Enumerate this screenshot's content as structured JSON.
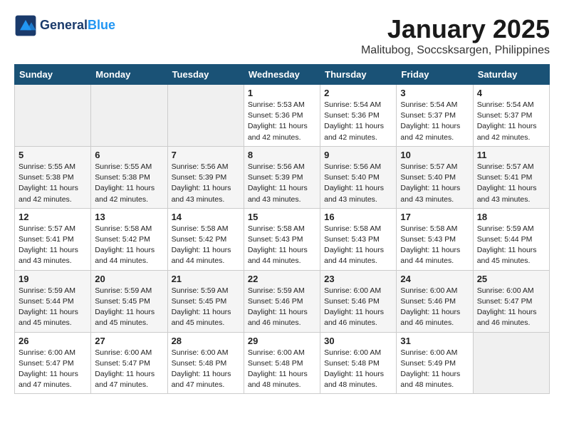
{
  "header": {
    "logo_line1": "General",
    "logo_line2": "Blue",
    "month": "January 2025",
    "location": "Malitubog, Soccsksargen, Philippines"
  },
  "days_of_week": [
    "Sunday",
    "Monday",
    "Tuesday",
    "Wednesday",
    "Thursday",
    "Friday",
    "Saturday"
  ],
  "weeks": [
    [
      {
        "day": "",
        "content": ""
      },
      {
        "day": "",
        "content": ""
      },
      {
        "day": "",
        "content": ""
      },
      {
        "day": "1",
        "content": "Sunrise: 5:53 AM\nSunset: 5:36 PM\nDaylight: 11 hours\nand 42 minutes."
      },
      {
        "day": "2",
        "content": "Sunrise: 5:54 AM\nSunset: 5:36 PM\nDaylight: 11 hours\nand 42 minutes."
      },
      {
        "day": "3",
        "content": "Sunrise: 5:54 AM\nSunset: 5:37 PM\nDaylight: 11 hours\nand 42 minutes."
      },
      {
        "day": "4",
        "content": "Sunrise: 5:54 AM\nSunset: 5:37 PM\nDaylight: 11 hours\nand 42 minutes."
      }
    ],
    [
      {
        "day": "5",
        "content": "Sunrise: 5:55 AM\nSunset: 5:38 PM\nDaylight: 11 hours\nand 42 minutes."
      },
      {
        "day": "6",
        "content": "Sunrise: 5:55 AM\nSunset: 5:38 PM\nDaylight: 11 hours\nand 42 minutes."
      },
      {
        "day": "7",
        "content": "Sunrise: 5:56 AM\nSunset: 5:39 PM\nDaylight: 11 hours\nand 43 minutes."
      },
      {
        "day": "8",
        "content": "Sunrise: 5:56 AM\nSunset: 5:39 PM\nDaylight: 11 hours\nand 43 minutes."
      },
      {
        "day": "9",
        "content": "Sunrise: 5:56 AM\nSunset: 5:40 PM\nDaylight: 11 hours\nand 43 minutes."
      },
      {
        "day": "10",
        "content": "Sunrise: 5:57 AM\nSunset: 5:40 PM\nDaylight: 11 hours\nand 43 minutes."
      },
      {
        "day": "11",
        "content": "Sunrise: 5:57 AM\nSunset: 5:41 PM\nDaylight: 11 hours\nand 43 minutes."
      }
    ],
    [
      {
        "day": "12",
        "content": "Sunrise: 5:57 AM\nSunset: 5:41 PM\nDaylight: 11 hours\nand 43 minutes."
      },
      {
        "day": "13",
        "content": "Sunrise: 5:58 AM\nSunset: 5:42 PM\nDaylight: 11 hours\nand 44 minutes."
      },
      {
        "day": "14",
        "content": "Sunrise: 5:58 AM\nSunset: 5:42 PM\nDaylight: 11 hours\nand 44 minutes."
      },
      {
        "day": "15",
        "content": "Sunrise: 5:58 AM\nSunset: 5:43 PM\nDaylight: 11 hours\nand 44 minutes."
      },
      {
        "day": "16",
        "content": "Sunrise: 5:58 AM\nSunset: 5:43 PM\nDaylight: 11 hours\nand 44 minutes."
      },
      {
        "day": "17",
        "content": "Sunrise: 5:58 AM\nSunset: 5:43 PM\nDaylight: 11 hours\nand 44 minutes."
      },
      {
        "day": "18",
        "content": "Sunrise: 5:59 AM\nSunset: 5:44 PM\nDaylight: 11 hours\nand 45 minutes."
      }
    ],
    [
      {
        "day": "19",
        "content": "Sunrise: 5:59 AM\nSunset: 5:44 PM\nDaylight: 11 hours\nand 45 minutes."
      },
      {
        "day": "20",
        "content": "Sunrise: 5:59 AM\nSunset: 5:45 PM\nDaylight: 11 hours\nand 45 minutes."
      },
      {
        "day": "21",
        "content": "Sunrise: 5:59 AM\nSunset: 5:45 PM\nDaylight: 11 hours\nand 45 minutes."
      },
      {
        "day": "22",
        "content": "Sunrise: 5:59 AM\nSunset: 5:46 PM\nDaylight: 11 hours\nand 46 minutes."
      },
      {
        "day": "23",
        "content": "Sunrise: 6:00 AM\nSunset: 5:46 PM\nDaylight: 11 hours\nand 46 minutes."
      },
      {
        "day": "24",
        "content": "Sunrise: 6:00 AM\nSunset: 5:46 PM\nDaylight: 11 hours\nand 46 minutes."
      },
      {
        "day": "25",
        "content": "Sunrise: 6:00 AM\nSunset: 5:47 PM\nDaylight: 11 hours\nand 46 minutes."
      }
    ],
    [
      {
        "day": "26",
        "content": "Sunrise: 6:00 AM\nSunset: 5:47 PM\nDaylight: 11 hours\nand 47 minutes."
      },
      {
        "day": "27",
        "content": "Sunrise: 6:00 AM\nSunset: 5:47 PM\nDaylight: 11 hours\nand 47 minutes."
      },
      {
        "day": "28",
        "content": "Sunrise: 6:00 AM\nSunset: 5:48 PM\nDaylight: 11 hours\nand 47 minutes."
      },
      {
        "day": "29",
        "content": "Sunrise: 6:00 AM\nSunset: 5:48 PM\nDaylight: 11 hours\nand 48 minutes."
      },
      {
        "day": "30",
        "content": "Sunrise: 6:00 AM\nSunset: 5:48 PM\nDaylight: 11 hours\nand 48 minutes."
      },
      {
        "day": "31",
        "content": "Sunrise: 6:00 AM\nSunset: 5:49 PM\nDaylight: 11 hours\nand 48 minutes."
      },
      {
        "day": "",
        "content": ""
      }
    ]
  ]
}
